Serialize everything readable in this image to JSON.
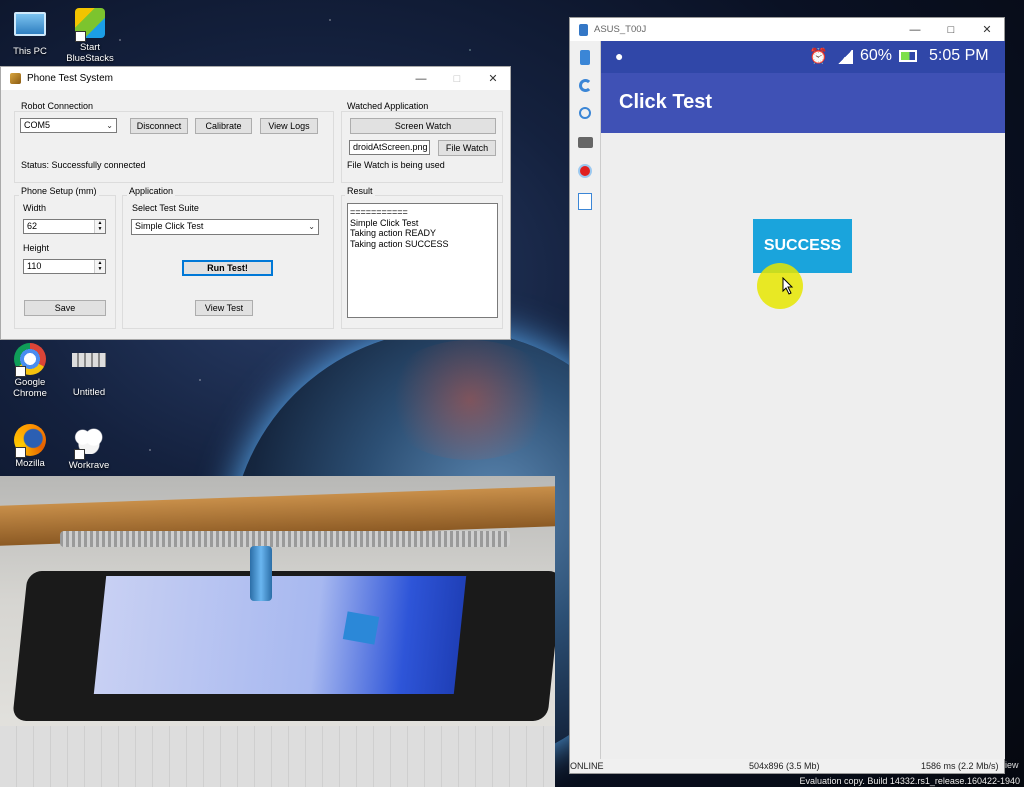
{
  "desktop": {
    "icons": [
      {
        "label": "This PC",
        "icon": "computer-icon"
      },
      {
        "label": "Start BlueStacks",
        "icon": "bluestacks-icon"
      },
      {
        "label": "Google Chrome",
        "icon": "chrome-icon"
      },
      {
        "label": "Untitled",
        "icon": "document-icon"
      },
      {
        "label": "Mozilla",
        "icon": "firefox-icon"
      },
      {
        "label": "Workrave",
        "icon": "sheep-icon"
      }
    ],
    "watermark": "Evaluation copy. Build 14332.rs1_release.160422-1940"
  },
  "test_window": {
    "title": "Phone Test System",
    "robot_connection": {
      "label": "Robot Connection",
      "port_value": "COM5",
      "disconnect_label": "Disconnect",
      "calibrate_label": "Calibrate",
      "view_logs_label": "View Logs",
      "status": "Status: Successfully connected"
    },
    "watched_application": {
      "label": "Watched Application",
      "screen_watch_label": "Screen Watch",
      "file_value": "droidAtScreen.png",
      "file_watch_label": "File Watch",
      "status": "File Watch is being used"
    },
    "phone_setup": {
      "label": "Phone Setup (mm)",
      "width_label": "Width",
      "width_value": "62",
      "height_label": "Height",
      "height_value": "110",
      "save_label": "Save"
    },
    "application": {
      "label": "Application",
      "suite_label": "Select Test Suite",
      "suite_value": "Simple Click Test",
      "run_label": "Run Test!",
      "view_label": "View Test"
    },
    "result": {
      "label": "Result",
      "lines": [
        "===========",
        "Simple Click Test",
        "Taking action READY",
        "Taking action SUCCESS"
      ]
    }
  },
  "emulator": {
    "title": "ASUS_T00J",
    "status": {
      "battery": "60%",
      "time": "5:05 PM"
    },
    "app_title": "Click Test",
    "button_label": "SUCCESS",
    "footer": {
      "state": "ONLINE",
      "size": "504x896 (3.5 Mb)",
      "timing": "1586 ms (2.2 Mb/s)",
      "overflow": "iew"
    }
  },
  "colors": {
    "appbar": "#3f51b5",
    "statusbar": "#3047a8",
    "success_button": "#1aa4dc",
    "cursor_halo": "#e6e600"
  }
}
